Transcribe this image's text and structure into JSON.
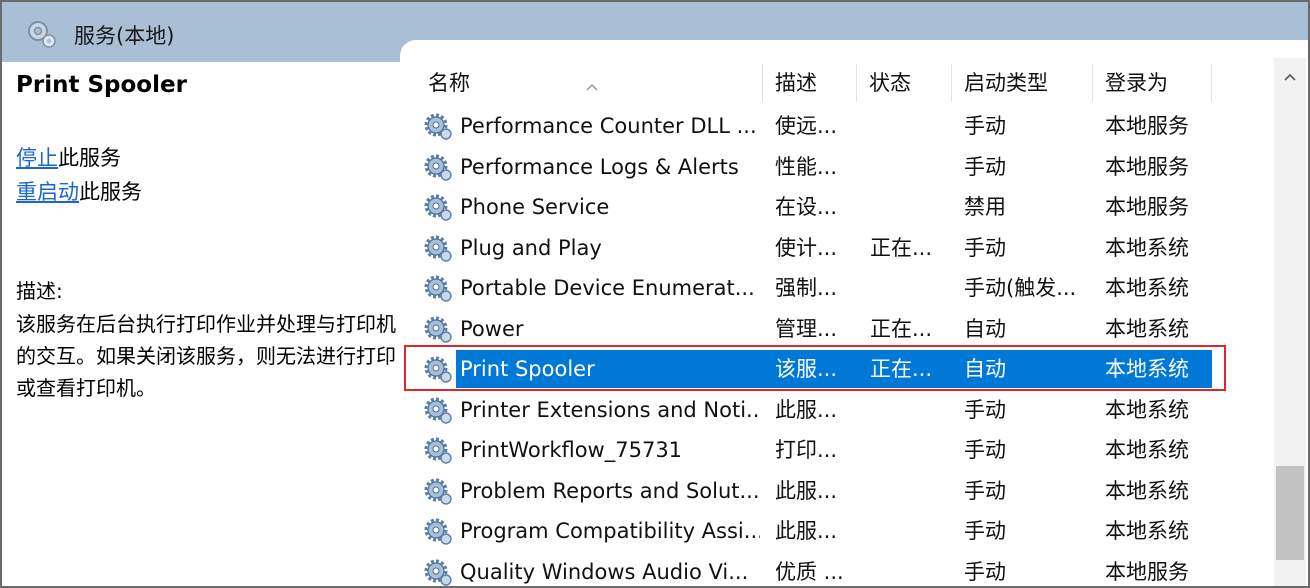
{
  "window": {
    "title": "服务(本地)",
    "icon": "services-gear-icon"
  },
  "details": {
    "service_name": "Print Spooler",
    "stop_link": "停止",
    "stop_suffix": "此服务",
    "restart_link": "重启动",
    "restart_suffix": "此服务",
    "description_label": "描述:",
    "description_text": "该服务在后台执行打印作业并处理与打印机的交互。如果关闭该服务，则无法进行打印或查看打印机。"
  },
  "table": {
    "columns": {
      "name": "名称",
      "description": "描述",
      "status": "状态",
      "startup_type": "启动类型",
      "log_on_as": "登录为"
    },
    "rows": [
      {
        "name": "Performance Counter DLL ...",
        "description": "使远...",
        "status": "",
        "startup_type": "手动",
        "log_on_as": "本地服务"
      },
      {
        "name": "Performance Logs & Alerts",
        "description": "性能...",
        "status": "",
        "startup_type": "手动",
        "log_on_as": "本地服务"
      },
      {
        "name": "Phone Service",
        "description": "在设...",
        "status": "",
        "startup_type": "禁用",
        "log_on_as": "本地服务"
      },
      {
        "name": "Plug and Play",
        "description": "使计...",
        "status": "正在...",
        "startup_type": "手动",
        "log_on_as": "本地系统"
      },
      {
        "name": "Portable Device Enumerat...",
        "description": "强制...",
        "status": "",
        "startup_type": "手动(触发...",
        "log_on_as": "本地系统"
      },
      {
        "name": "Power",
        "description": "管理...",
        "status": "正在...",
        "startup_type": "自动",
        "log_on_as": "本地系统"
      },
      {
        "name": "Print Spooler",
        "description": "该服...",
        "status": "正在...",
        "startup_type": "自动",
        "log_on_as": "本地系统",
        "selected": true
      },
      {
        "name": "Printer Extensions and Noti...",
        "description": "此服...",
        "status": "",
        "startup_type": "手动",
        "log_on_as": "本地系统"
      },
      {
        "name": "PrintWorkflow_75731",
        "description": "打印...",
        "status": "",
        "startup_type": "手动",
        "log_on_as": "本地系统"
      },
      {
        "name": "Problem Reports and Solut...",
        "description": "此服...",
        "status": "",
        "startup_type": "手动",
        "log_on_as": "本地系统"
      },
      {
        "name": "Program Compatibility Assi...",
        "description": "此服...",
        "status": "",
        "startup_type": "手动",
        "log_on_as": "本地系统"
      },
      {
        "name": "Quality Windows Audio Vi...",
        "description": "优质 ...",
        "status": "",
        "startup_type": "手动",
        "log_on_as": "本地服务"
      }
    ]
  },
  "colors": {
    "titlebar_bg": "#a9bfd6",
    "selection_bg": "#0078d7",
    "highlight_border": "#e0262a",
    "link": "#1a66d0"
  }
}
